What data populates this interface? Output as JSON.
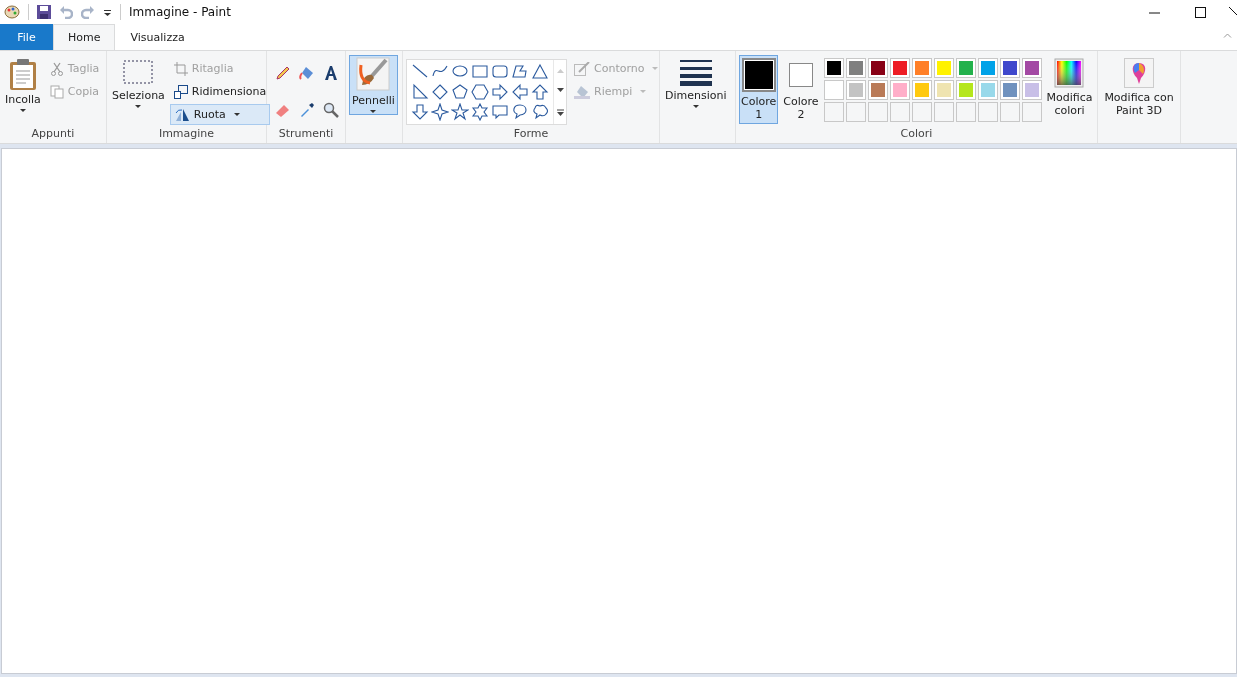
{
  "window": {
    "title": "Immagine - Paint"
  },
  "tabs": [
    {
      "label": "File",
      "kind": "file"
    },
    {
      "label": "Home",
      "kind": "tab",
      "selected": true
    },
    {
      "label": "Visualizza",
      "kind": "tab",
      "selected": false
    }
  ],
  "clipboard": {
    "group": "Appunti",
    "paste": "Incolla",
    "items": [
      {
        "label": "Taglia",
        "kind": "cut",
        "disabled": true
      },
      {
        "label": "Copia",
        "kind": "copy",
        "disabled": true
      }
    ]
  },
  "image": {
    "group": "Immagine",
    "select": "Seleziona",
    "items": [
      {
        "label": "Ritaglia",
        "kind": "crop",
        "disabled": true,
        "selected": false
      },
      {
        "label": "Ridimensiona",
        "kind": "resize",
        "disabled": false,
        "selected": false
      },
      {
        "label": "Ruota",
        "kind": "rotate",
        "disabled": false,
        "selected": true
      }
    ]
  },
  "tools": {
    "group": "Strumenti"
  },
  "brushes": {
    "label": "Pennelli",
    "selected": true
  },
  "shapes": {
    "group": "Forme",
    "items": [
      {
        "kind": "line"
      },
      {
        "kind": "curve"
      },
      {
        "kind": "oval"
      },
      {
        "kind": "rect"
      },
      {
        "kind": "roundrect"
      },
      {
        "kind": "polygon"
      },
      {
        "kind": "triangle"
      },
      {
        "kind": "right-triangle"
      },
      {
        "kind": "diamond"
      },
      {
        "kind": "pentagon"
      },
      {
        "kind": "hexagon"
      },
      {
        "kind": "arrow-right"
      },
      {
        "kind": "arrow-left"
      },
      {
        "kind": "arrow-up"
      },
      {
        "kind": "arrow-down"
      },
      {
        "kind": "star4"
      },
      {
        "kind": "star5"
      },
      {
        "kind": "star6"
      },
      {
        "kind": "callout-rect"
      },
      {
        "kind": "callout-oval"
      },
      {
        "kind": "callout-cloud"
      }
    ],
    "outline": {
      "label": "Contorno",
      "disabled": true
    },
    "fill": {
      "label": "Riempi",
      "disabled": true
    }
  },
  "size": {
    "label": "Dimensioni"
  },
  "colors": {
    "group": "Colori",
    "current": [
      {
        "label": "Colore",
        "number": "1",
        "color": "#000000",
        "selected": true
      },
      {
        "label": "Colore",
        "number": "2",
        "color": "#ffffff",
        "selected": false
      }
    ],
    "palette": [
      {
        "color": "#000000"
      },
      {
        "color": "#7f7f7f"
      },
      {
        "color": "#880015"
      },
      {
        "color": "#ed1c24"
      },
      {
        "color": "#ff7f27"
      },
      {
        "color": "#fff200"
      },
      {
        "color": "#22b14c"
      },
      {
        "color": "#00a2e8"
      },
      {
        "color": "#3f48cc"
      },
      {
        "color": "#a349a4"
      },
      {
        "color": "#ffffff"
      },
      {
        "color": "#c3c3c3"
      },
      {
        "color": "#b97a57"
      },
      {
        "color": "#ffaec9"
      },
      {
        "color": "#ffc90e"
      },
      {
        "color": "#efe4b0"
      },
      {
        "color": "#b5e61d"
      },
      {
        "color": "#99d9ea"
      },
      {
        "color": "#7092be"
      },
      {
        "color": "#c8bfe7"
      }
    ],
    "edit": "Modifica colori"
  },
  "paint3d": {
    "label": "Modifica con Paint 3D"
  }
}
